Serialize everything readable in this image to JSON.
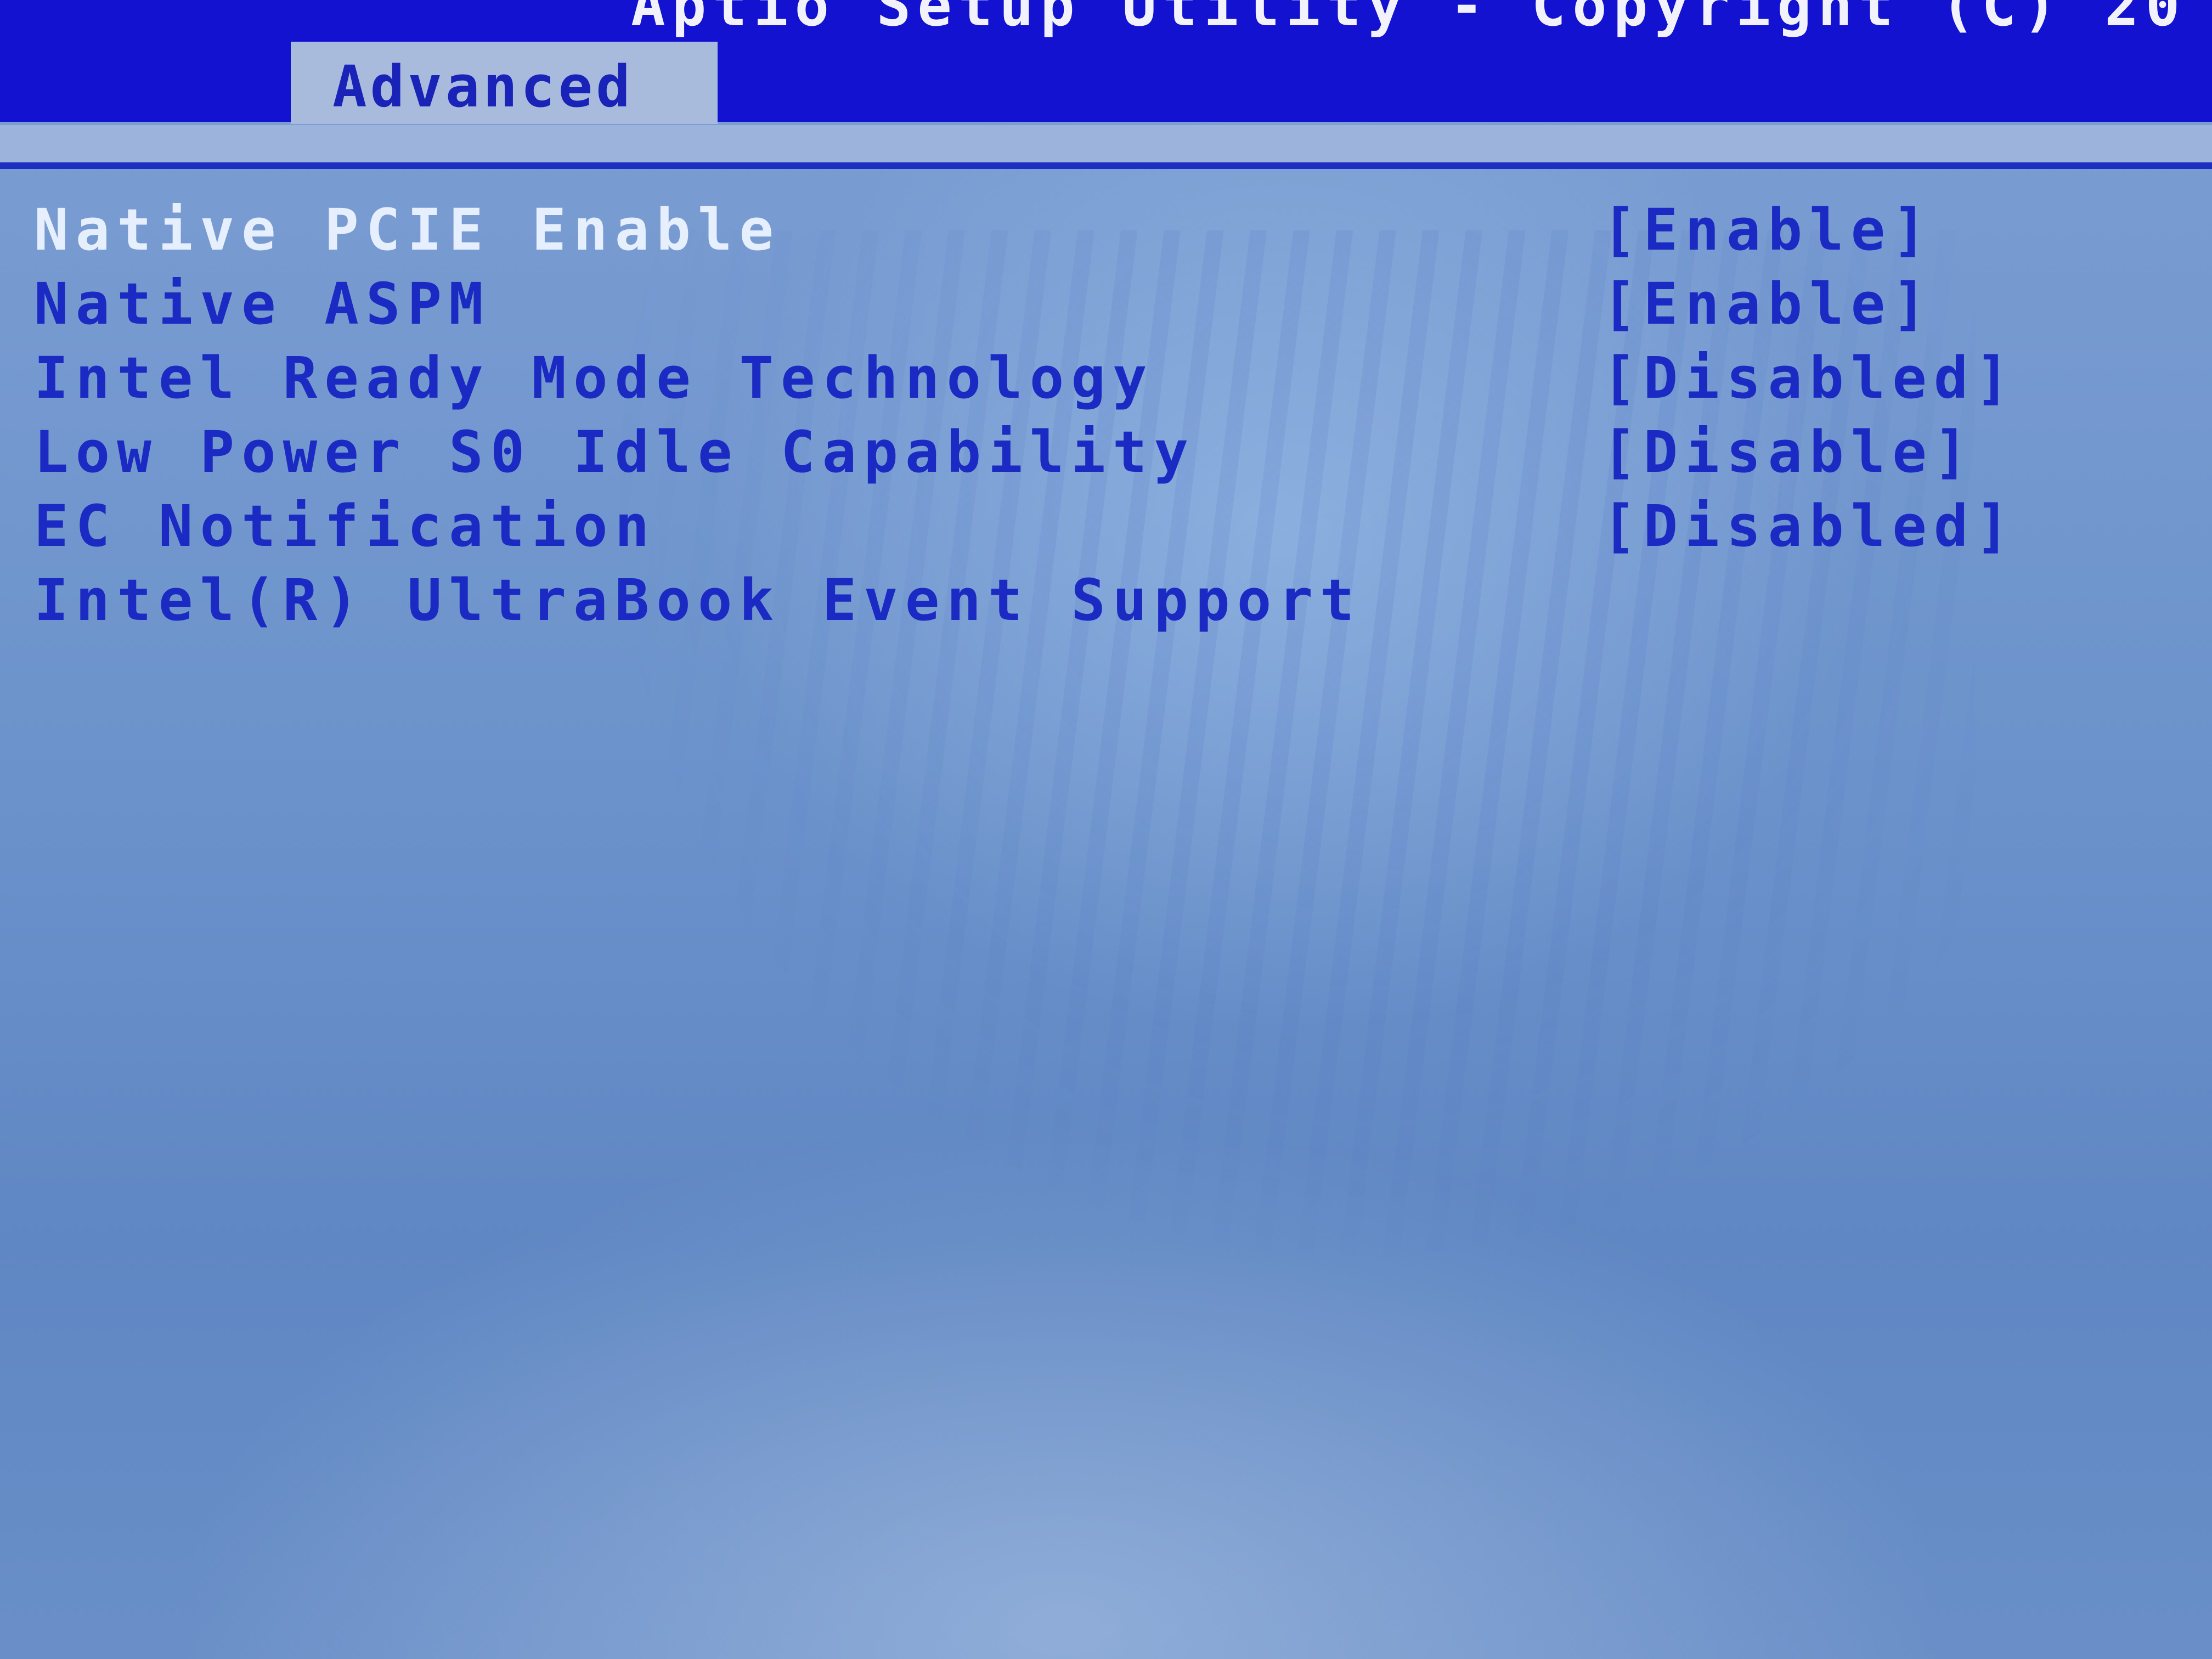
{
  "header": {
    "title": "Aptio Setup Utility - Copyright (C) 20"
  },
  "tabs": [
    {
      "label": "Advanced"
    }
  ],
  "settings": [
    {
      "label": "Native PCIE Enable",
      "value": "[Enable]"
    },
    {
      "label": "Native ASPM",
      "value": "[Enable]"
    },
    {
      "label": "Intel Ready Mode Technology",
      "value": "[Disabled]"
    },
    {
      "label": "Low Power S0 Idle Capability",
      "value": "[Disable]"
    },
    {
      "label": "EC Notification",
      "value": "[Disabled]"
    },
    {
      "label": "Intel(R) UltraBook Event Support"
    }
  ],
  "colors": {
    "header_blue": "#1212d0",
    "text_blue": "#1a2ac2",
    "highlight_text": "#e6efff",
    "background": "#7c9fd3"
  }
}
